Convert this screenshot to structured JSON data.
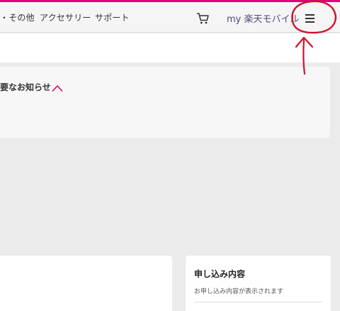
{
  "header": {
    "nav_items": [
      {
        "label": "・その他"
      },
      {
        "label": "アクセサリー"
      },
      {
        "label": "サポート"
      }
    ],
    "my_link": "my 楽天モバイル",
    "cart_icon": "cart-icon",
    "menu_icon": "hamburger-menu-icon"
  },
  "notice": {
    "title": "要なお知らせ",
    "toggle_icon": "chevron-up-icon"
  },
  "application_card": {
    "title": "申し込み内容",
    "description": "お申し込み内容が表示されます"
  },
  "colors": {
    "accent": "#e0007a",
    "annotation": "#d0112b",
    "link": "#4b4b82"
  }
}
